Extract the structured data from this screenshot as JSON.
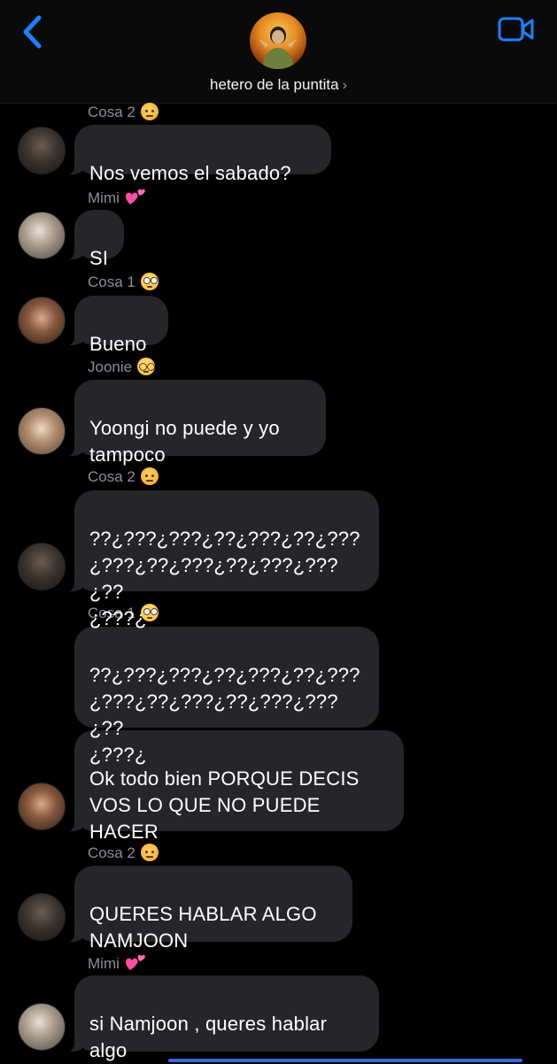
{
  "header": {
    "group_name": "hetero de la puntita",
    "chevron": "›",
    "back_icon": "chevron-left-icon",
    "video_icon": "video-camera-icon",
    "accent_color": "#1a82ff"
  },
  "messages": [
    {
      "sender": "Cosa 2",
      "sender_emoji": "angry-face",
      "text": "Nos vemos el sabado?"
    },
    {
      "sender": "Mimi",
      "sender_emoji": "two-hearts",
      "text": "SI"
    },
    {
      "sender": "Cosa 1",
      "sender_emoji": "rolling-eyes",
      "text": "Bueno"
    },
    {
      "sender": "Joonie",
      "sender_emoji": "nerd-face",
      "text": "Yoongi no puede y yo\ntampoco"
    },
    {
      "sender": "Cosa 2",
      "sender_emoji": "angry-face",
      "text": "??¿???¿???¿??¿???¿??¿???\n¿???¿??¿???¿??¿???¿???¿??\n¿???¿"
    },
    {
      "sender": "Cosa 1",
      "sender_emoji": "rolling-eyes",
      "text": "??¿???¿???¿??¿???¿??¿???\n¿???¿??¿???¿??¿???¿???¿??\n¿???¿"
    },
    {
      "sender": "",
      "sender_emoji": "",
      "text": "Ok todo bien PORQUE DECIS\nVOS LO QUE NO PUEDE\nHACER"
    },
    {
      "sender": "Cosa 2",
      "sender_emoji": "angry-face",
      "text": "QUERES HABLAR ALGO\nNAMJOON"
    },
    {
      "sender": "Mimi",
      "sender_emoji": "two-hearts",
      "text": "si Namjoon , queres hablar\nalgo"
    }
  ]
}
